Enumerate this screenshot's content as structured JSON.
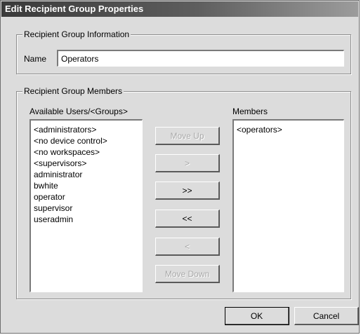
{
  "window": {
    "title": "Edit Recipient Group Properties"
  },
  "info_group": {
    "legend": "Recipient Group Information",
    "name_label": "Name",
    "name_value": "Operators"
  },
  "members_group": {
    "legend": "Recipient Group Members",
    "available_label": "Available Users/<Groups>",
    "members_label": "Members",
    "available_items": [
      "<administrators>",
      "<no device control>",
      "<no workspaces>",
      "<supervisors>",
      "administrator",
      "bwhite",
      "operator",
      "supervisor",
      "useradmin"
    ],
    "member_items": [
      "<operators>"
    ],
    "buttons": {
      "move_up": "Move Up",
      "add": ">",
      "add_all": ">>",
      "remove_all": "<<",
      "remove": "<",
      "move_down": "Move Down"
    }
  },
  "footer": {
    "ok": "OK",
    "cancel": "Cancel"
  }
}
